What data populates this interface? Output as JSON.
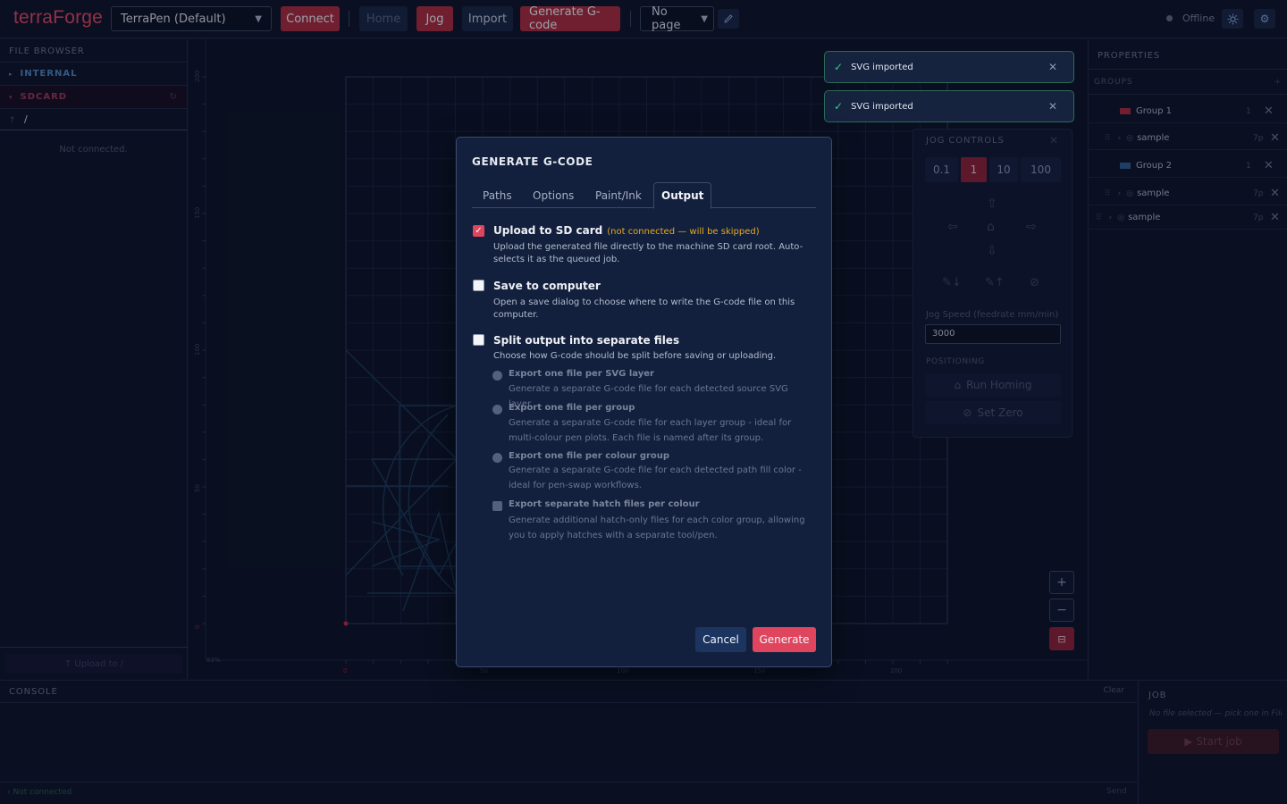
{
  "app": {
    "logo": "terraForge"
  },
  "toolbar": {
    "machine_select": "TerraPen (Default)",
    "connect": "Connect",
    "home": "Home",
    "jog": "Jog",
    "import": "Import",
    "generate_gcode": "Generate G-code",
    "page_select": "No page",
    "status": "Offline"
  },
  "file_browser": {
    "title": "FILE BROWSER",
    "internal": "INTERNAL",
    "sdcard": "SDCARD",
    "path": "/",
    "empty": "Not connected.",
    "upload": "↑ Upload to /"
  },
  "canvas": {
    "y_ticks": [
      "200",
      "150",
      "100",
      "50",
      "0"
    ],
    "x_ticks": [
      "0",
      "50",
      "100",
      "150",
      "200"
    ],
    "zoom_label": "83%"
  },
  "properties": {
    "title": "PROPERTIES",
    "groups_label": "GROUPS",
    "add": "+",
    "rows": [
      {
        "name": "Group 1",
        "count": "1",
        "color": "#a82c3e"
      },
      {
        "name": "sample",
        "count": "7p"
      },
      {
        "name": "Group 2",
        "count": "1",
        "color": "#2c5b8c"
      },
      {
        "name": "sample",
        "count": "7p"
      },
      {
        "name": "sample",
        "count": "7p"
      }
    ]
  },
  "jog_controls": {
    "title": "JOG CONTROLS",
    "steps": [
      "0.1",
      "1",
      "10",
      "100"
    ],
    "active_step": "1",
    "speed_label": "Jog Speed (feedrate mm/min)",
    "speed_value": "3000",
    "positioning": "POSITIONING",
    "run_homing": "Run Homing",
    "set_zero": "Set Zero"
  },
  "toasts": [
    {
      "text": "SVG imported"
    },
    {
      "text": "SVG imported"
    }
  ],
  "modal": {
    "title": "GENERATE G-CODE",
    "tabs": [
      "Paths",
      "Options",
      "Paint/Ink",
      "Output"
    ],
    "active_tab": "Output",
    "upload_sd": {
      "title": "Upload to SD card",
      "warning": "(not connected — will be skipped)",
      "desc": "Upload the generated file directly to the machine SD card root. Auto-selects it as the queued job.",
      "checked": true
    },
    "save_computer": {
      "title": "Save to computer",
      "desc": "Open a save dialog to choose where to write the G-code file on this computer.",
      "checked": false
    },
    "split_output": {
      "title": "Split output into separate files",
      "desc": "Choose how G-code should be split before saving or uploading.",
      "checked": false,
      "options": [
        {
          "title": "Export one file per SVG layer",
          "desc": "Generate a separate G-code file for each detected source SVG layer."
        },
        {
          "title": "Export one file per group",
          "desc": "Generate a separate G-code file for each layer group - ideal for multi-colour pen plots. Each file is named after its group."
        },
        {
          "title": "Export one file per colour group",
          "desc": "Generate a separate G-code file for each detected path fill color - ideal for pen-swap workflows."
        },
        {
          "title": "Export separate hatch files per colour",
          "desc": "Generate additional hatch-only files for each color group, allowing you to apply hatches with a separate tool/pen."
        }
      ]
    },
    "cancel": "Cancel",
    "generate": "Generate"
  },
  "console": {
    "title": "CONSOLE",
    "clear": "Clear",
    "prompt": "› Not connected",
    "send": "Send"
  },
  "job": {
    "title": "JOB",
    "subtitle": "No file selected — pick one in File Browser",
    "start": "▶ Start job"
  },
  "colors": {
    "accent": "#e0455e",
    "toolbar_red": "#a82c3e",
    "warning": "#e6a91e",
    "success": "#3ec58c"
  }
}
